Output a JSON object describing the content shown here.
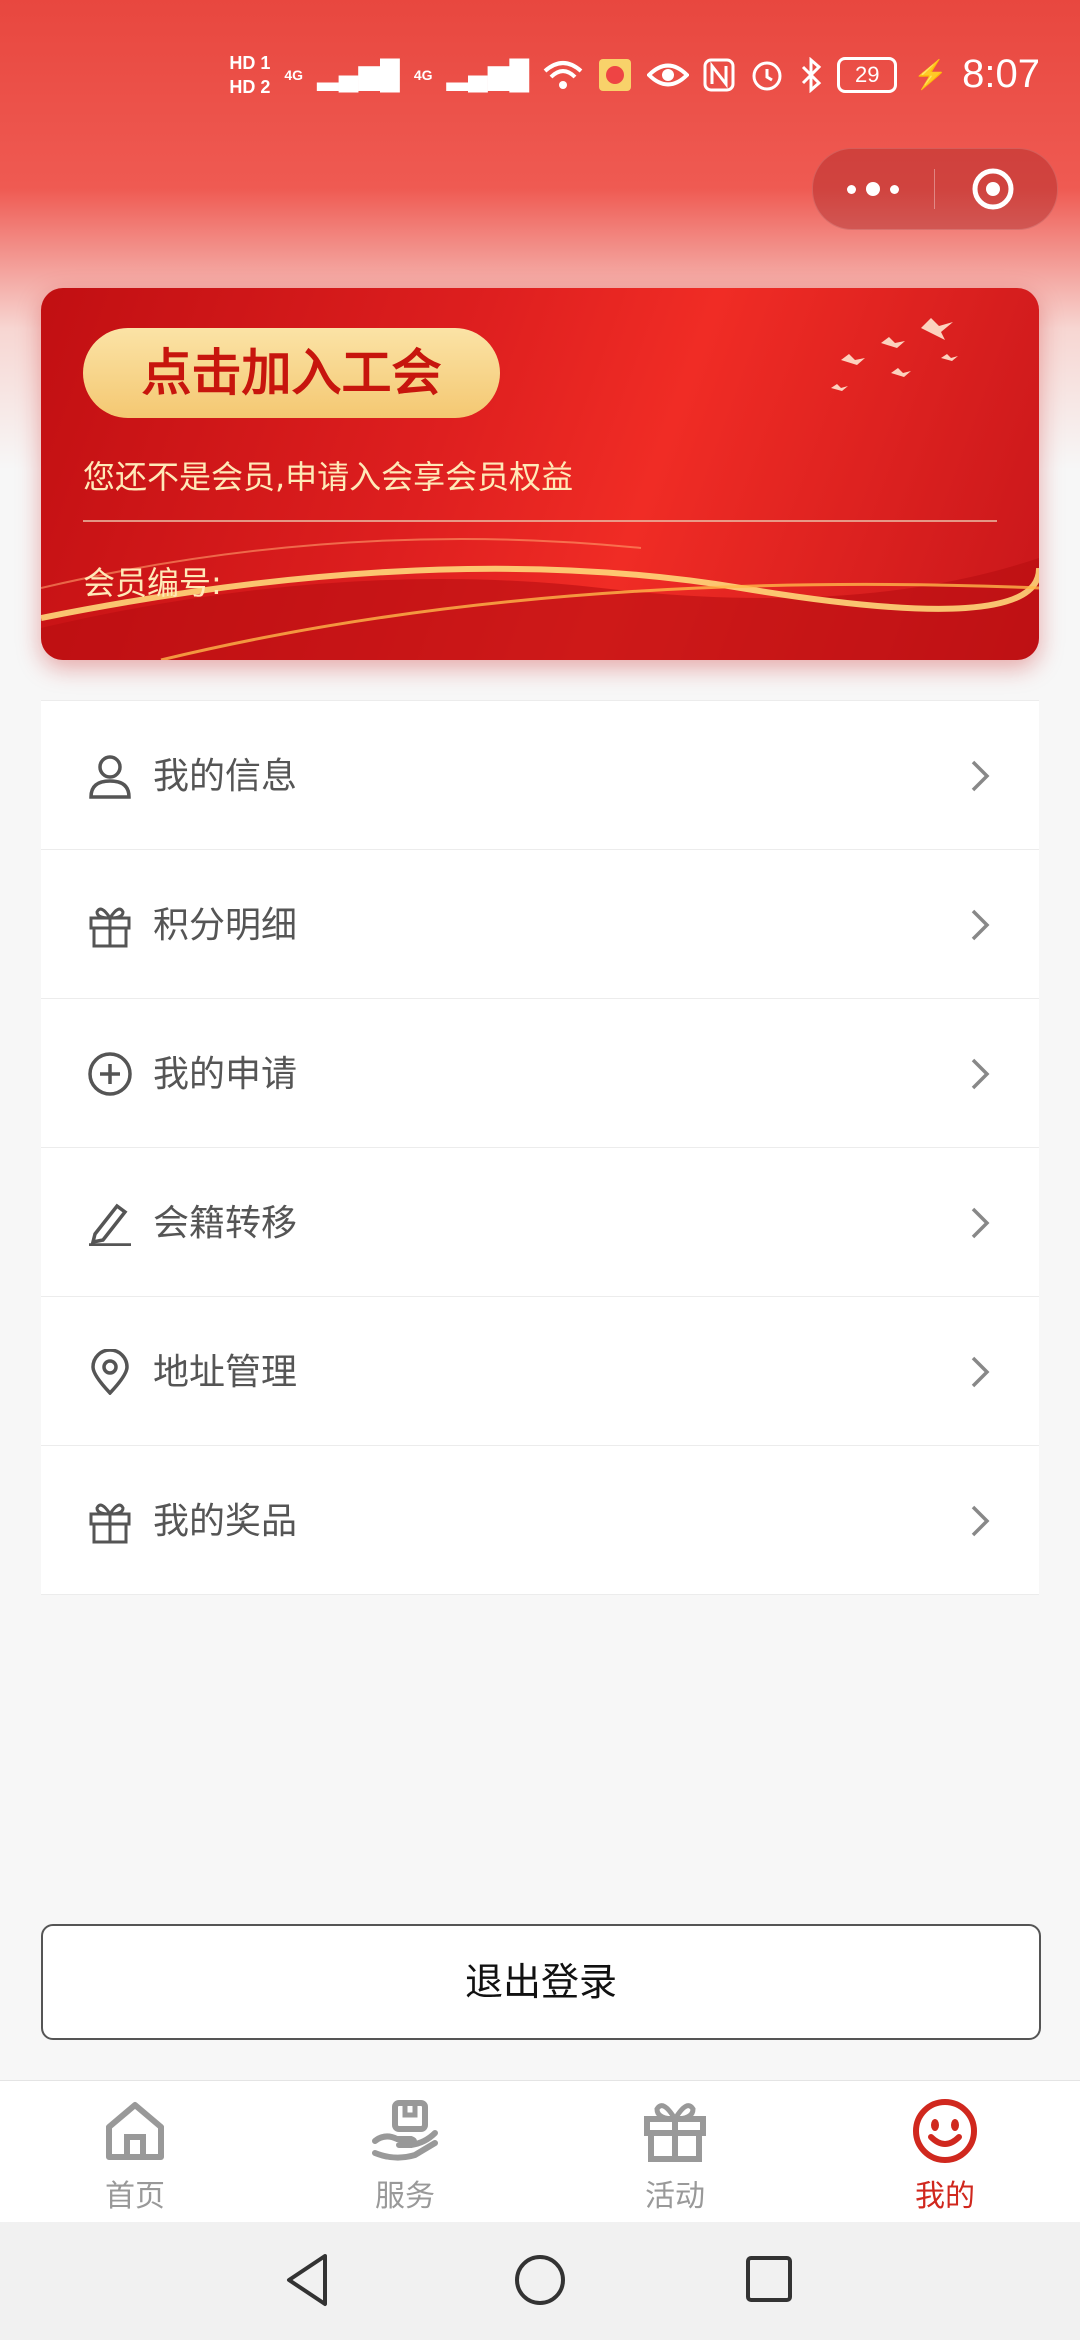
{
  "status_bar": {
    "hd1": "HD 1",
    "hd2": "HD 2",
    "net1": "4G",
    "net2": "4G",
    "battery": "29",
    "time": "8:07"
  },
  "card": {
    "join_button": "点击加入工会",
    "subtitle": "您还不是会员,申请入会享会员权益",
    "member_number_label": "会员编号:"
  },
  "menu": [
    {
      "label": "我的信息",
      "icon": "user-icon"
    },
    {
      "label": "积分明细",
      "icon": "gift-icon"
    },
    {
      "label": "我的申请",
      "icon": "plus-circle-icon"
    },
    {
      "label": "会籍转移",
      "icon": "pencil-icon"
    },
    {
      "label": "地址管理",
      "icon": "location-pin-icon"
    },
    {
      "label": "我的奖品",
      "icon": "gift-icon"
    }
  ],
  "logout_label": "退出登录",
  "tabs": [
    {
      "label": "首页",
      "icon": "home-icon",
      "active": false
    },
    {
      "label": "服务",
      "icon": "service-hand-icon",
      "active": false
    },
    {
      "label": "活动",
      "icon": "gift-icon",
      "active": false
    },
    {
      "label": "我的",
      "icon": "smiley-icon",
      "active": true
    }
  ],
  "colors": {
    "primary_red": "#e8473f",
    "active_tab": "#d0281e",
    "gold": "#f4c872",
    "tab_inactive": "#999999"
  }
}
